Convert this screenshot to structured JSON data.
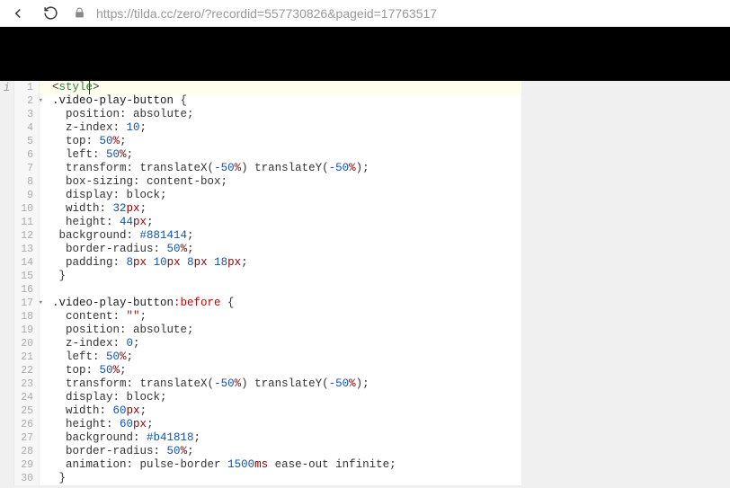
{
  "toolbar": {
    "url": "https://tilda.cc/zero/?recordid=557730826&pageid=17763517"
  },
  "gutter_icon": "i",
  "code": {
    "lines": [
      {
        "n": 1,
        "fold": true,
        "hl": true,
        "tokens": [
          [
            "<",
            "t-brace"
          ],
          [
            "style",
            "t-tag"
          ],
          [
            ">",
            "t-brace"
          ]
        ]
      },
      {
        "n": 2,
        "fold": true,
        "tokens": [
          [
            ".video-play-button",
            "t-sel"
          ],
          [
            " {",
            "t-brace"
          ]
        ]
      },
      {
        "n": 3,
        "tokens": [
          [
            "  position",
            "t-prop"
          ],
          [
            ": ",
            "t-brace"
          ],
          [
            "absolute",
            "t-kw"
          ],
          [
            ";",
            "t-brace"
          ]
        ]
      },
      {
        "n": 4,
        "tokens": [
          [
            "  z-index",
            "t-prop"
          ],
          [
            ": ",
            "t-brace"
          ],
          [
            "10",
            "t-num"
          ],
          [
            ";",
            "t-brace"
          ]
        ]
      },
      {
        "n": 5,
        "tokens": [
          [
            "  top",
            "t-prop"
          ],
          [
            ": ",
            "t-brace"
          ],
          [
            "50",
            "t-num"
          ],
          [
            "%",
            "t-unit"
          ],
          [
            ";",
            "t-brace"
          ]
        ]
      },
      {
        "n": 6,
        "tokens": [
          [
            "  left",
            "t-prop"
          ],
          [
            ": ",
            "t-brace"
          ],
          [
            "50",
            "t-num"
          ],
          [
            "%",
            "t-unit"
          ],
          [
            ";",
            "t-brace"
          ]
        ]
      },
      {
        "n": 7,
        "tokens": [
          [
            "  transform",
            "t-prop"
          ],
          [
            ": ",
            "t-brace"
          ],
          [
            "translateX",
            "t-kw"
          ],
          [
            "(",
            "t-brace"
          ],
          [
            "-50",
            "t-num"
          ],
          [
            "%",
            "t-unit"
          ],
          [
            ") ",
            "t-brace"
          ],
          [
            "translateY",
            "t-kw"
          ],
          [
            "(",
            "t-brace"
          ],
          [
            "-50",
            "t-num"
          ],
          [
            "%",
            "t-unit"
          ],
          [
            ");",
            "t-brace"
          ]
        ]
      },
      {
        "n": 8,
        "tokens": [
          [
            "  box-sizing",
            "t-prop"
          ],
          [
            ": ",
            "t-brace"
          ],
          [
            "content-box",
            "t-kw"
          ],
          [
            ";",
            "t-brace"
          ]
        ]
      },
      {
        "n": 9,
        "tokens": [
          [
            "  display",
            "t-prop"
          ],
          [
            ": ",
            "t-brace"
          ],
          [
            "block",
            "t-kw"
          ],
          [
            ";",
            "t-brace"
          ]
        ]
      },
      {
        "n": 10,
        "tokens": [
          [
            "  width",
            "t-prop"
          ],
          [
            ": ",
            "t-brace"
          ],
          [
            "32",
            "t-num"
          ],
          [
            "px",
            "t-unit"
          ],
          [
            ";",
            "t-brace"
          ]
        ]
      },
      {
        "n": 11,
        "tokens": [
          [
            "  height",
            "t-prop"
          ],
          [
            ": ",
            "t-brace"
          ],
          [
            "44",
            "t-num"
          ],
          [
            "px",
            "t-unit"
          ],
          [
            ";",
            "t-brace"
          ]
        ]
      },
      {
        "n": 12,
        "tokens": [
          [
            " background",
            "t-prop"
          ],
          [
            ": ",
            "t-brace"
          ],
          [
            "#881414",
            "t-hex"
          ],
          [
            ";",
            "t-brace"
          ]
        ]
      },
      {
        "n": 13,
        "tokens": [
          [
            "  border-radius",
            "t-prop"
          ],
          [
            ": ",
            "t-brace"
          ],
          [
            "50",
            "t-num"
          ],
          [
            "%",
            "t-unit"
          ],
          [
            ";",
            "t-brace"
          ]
        ]
      },
      {
        "n": 14,
        "tokens": [
          [
            "  padding",
            "t-prop"
          ],
          [
            ": ",
            "t-brace"
          ],
          [
            "8",
            "t-num"
          ],
          [
            "px ",
            "t-unit"
          ],
          [
            "10",
            "t-num"
          ],
          [
            "px ",
            "t-unit"
          ],
          [
            "8",
            "t-num"
          ],
          [
            "px ",
            "t-unit"
          ],
          [
            "18",
            "t-num"
          ],
          [
            "px",
            "t-unit"
          ],
          [
            ";",
            "t-brace"
          ]
        ]
      },
      {
        "n": 15,
        "tokens": [
          [
            " }",
            "t-brace"
          ]
        ]
      },
      {
        "n": 16,
        "tokens": []
      },
      {
        "n": 17,
        "fold": true,
        "tokens": [
          [
            ".video-play-button",
            "t-sel"
          ],
          [
            ":before",
            "t-pseudo"
          ],
          [
            " {",
            "t-brace"
          ]
        ]
      },
      {
        "n": 18,
        "tokens": [
          [
            "  content",
            "t-prop"
          ],
          [
            ": ",
            "t-brace"
          ],
          [
            "\"\"",
            "t-str"
          ],
          [
            ";",
            "t-brace"
          ]
        ]
      },
      {
        "n": 19,
        "tokens": [
          [
            "  position",
            "t-prop"
          ],
          [
            ": ",
            "t-brace"
          ],
          [
            "absolute",
            "t-kw"
          ],
          [
            ";",
            "t-brace"
          ]
        ]
      },
      {
        "n": 20,
        "tokens": [
          [
            "  z-index",
            "t-prop"
          ],
          [
            ": ",
            "t-brace"
          ],
          [
            "0",
            "t-num"
          ],
          [
            ";",
            "t-brace"
          ]
        ]
      },
      {
        "n": 21,
        "tokens": [
          [
            "  left",
            "t-prop"
          ],
          [
            ": ",
            "t-brace"
          ],
          [
            "50",
            "t-num"
          ],
          [
            "%",
            "t-unit"
          ],
          [
            ";",
            "t-brace"
          ]
        ]
      },
      {
        "n": 22,
        "tokens": [
          [
            "  top",
            "t-prop"
          ],
          [
            ": ",
            "t-brace"
          ],
          [
            "50",
            "t-num"
          ],
          [
            "%",
            "t-unit"
          ],
          [
            ";",
            "t-brace"
          ]
        ]
      },
      {
        "n": 23,
        "tokens": [
          [
            "  transform",
            "t-prop"
          ],
          [
            ": ",
            "t-brace"
          ],
          [
            "translateX",
            "t-kw"
          ],
          [
            "(",
            "t-brace"
          ],
          [
            "-50",
            "t-num"
          ],
          [
            "%",
            "t-unit"
          ],
          [
            ") ",
            "t-brace"
          ],
          [
            "translateY",
            "t-kw"
          ],
          [
            "(",
            "t-brace"
          ],
          [
            "-50",
            "t-num"
          ],
          [
            "%",
            "t-unit"
          ],
          [
            ");",
            "t-brace"
          ]
        ]
      },
      {
        "n": 24,
        "tokens": [
          [
            "  display",
            "t-prop"
          ],
          [
            ": ",
            "t-brace"
          ],
          [
            "block",
            "t-kw"
          ],
          [
            ";",
            "t-brace"
          ]
        ]
      },
      {
        "n": 25,
        "tokens": [
          [
            "  width",
            "t-prop"
          ],
          [
            ": ",
            "t-brace"
          ],
          [
            "60",
            "t-num"
          ],
          [
            "px",
            "t-unit"
          ],
          [
            ";",
            "t-brace"
          ]
        ]
      },
      {
        "n": 26,
        "tokens": [
          [
            "  height",
            "t-prop"
          ],
          [
            ": ",
            "t-brace"
          ],
          [
            "60",
            "t-num"
          ],
          [
            "px",
            "t-unit"
          ],
          [
            ";",
            "t-brace"
          ]
        ]
      },
      {
        "n": 27,
        "tokens": [
          [
            "  background",
            "t-prop"
          ],
          [
            ": ",
            "t-brace"
          ],
          [
            "#b41818",
            "t-hex"
          ],
          [
            ";",
            "t-brace"
          ]
        ]
      },
      {
        "n": 28,
        "tokens": [
          [
            "  border-radius",
            "t-prop"
          ],
          [
            ": ",
            "t-brace"
          ],
          [
            "50",
            "t-num"
          ],
          [
            "%",
            "t-unit"
          ],
          [
            ";",
            "t-brace"
          ]
        ]
      },
      {
        "n": 29,
        "tokens": [
          [
            "  animation",
            "t-prop"
          ],
          [
            ": ",
            "t-brace"
          ],
          [
            "pulse-border ",
            "t-kw"
          ],
          [
            "1500",
            "t-num"
          ],
          [
            "ms ",
            "t-unit"
          ],
          [
            "ease-out infinite",
            "t-kw"
          ],
          [
            ";",
            "t-brace"
          ]
        ]
      },
      {
        "n": 30,
        "tokens": [
          [
            " }",
            "t-brace"
          ]
        ]
      }
    ]
  }
}
